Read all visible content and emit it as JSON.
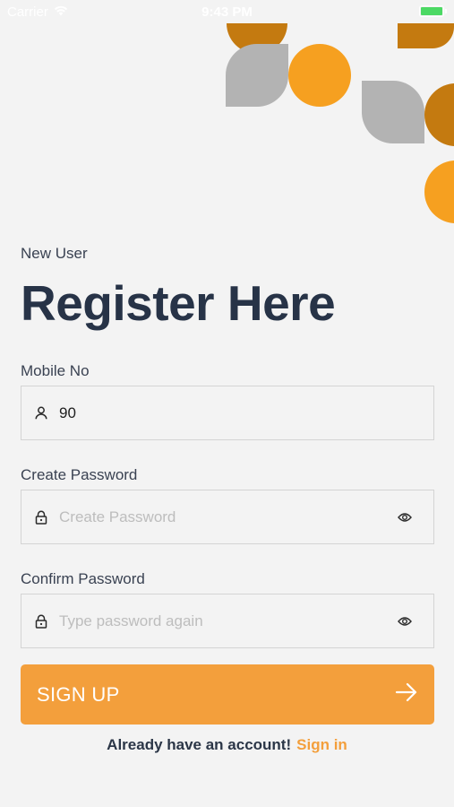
{
  "status_bar": {
    "carrier": "Carrier",
    "time": "9:43 PM",
    "wifi_icon": "wifi-icon",
    "battery_icon": "battery-icon"
  },
  "colors": {
    "accent": "#f39f3c",
    "heading": "#273347",
    "background": "#f3f3f3",
    "deco_orange_dark": "#c47a10",
    "deco_orange": "#f6a020",
    "deco_gray": "#b3b3b3"
  },
  "header": {
    "subtitle": "New User",
    "title": "Register Here"
  },
  "form": {
    "mobile": {
      "label": "Mobile No",
      "value": "90",
      "icon": "user-icon"
    },
    "password": {
      "label": "Create Password",
      "placeholder": "Create Password",
      "value": "",
      "icon": "lock-icon",
      "toggle_icon": "eye-icon"
    },
    "confirm": {
      "label": "Confirm Password",
      "placeholder": "Type password again",
      "value": "",
      "icon": "lock-icon",
      "toggle_icon": "eye-icon"
    },
    "submit": {
      "label": "SIGN UP",
      "icon": "arrow-right-icon"
    }
  },
  "footer": {
    "question": "Already have an account!",
    "link": "Sign in"
  }
}
